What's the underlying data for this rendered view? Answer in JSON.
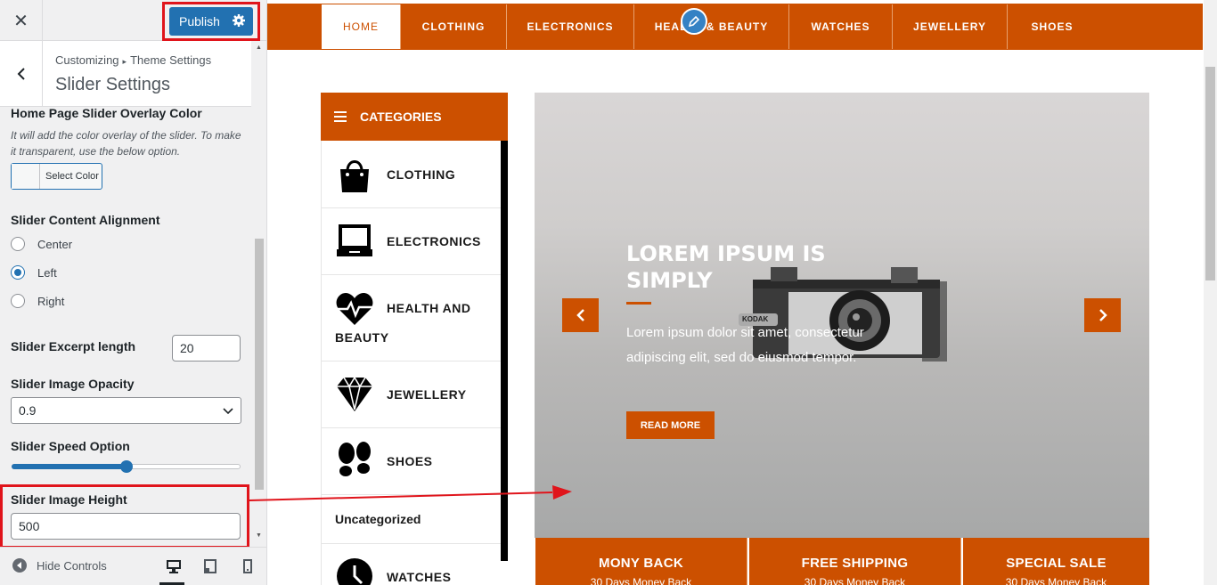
{
  "customizer": {
    "close_glyph": "✕",
    "publish_label": "Publish",
    "breadcrumb": {
      "root": "Customizing",
      "separator": "▸",
      "parent": "Theme Settings"
    },
    "section_title": "Slider Settings",
    "overlay_color": {
      "label": "Home Page Slider Overlay Color",
      "description": "It will add the color overlay of the slider. To make it transparent, use the below option.",
      "button_label": "Select Color"
    },
    "alignment": {
      "label": "Slider Content Alignment",
      "options": [
        {
          "label": "Center",
          "checked": false
        },
        {
          "label": "Left",
          "checked": true
        },
        {
          "label": "Right",
          "checked": false
        }
      ]
    },
    "excerpt": {
      "label": "Slider Excerpt length",
      "value": "20"
    },
    "opacity": {
      "label": "Slider Image Opacity",
      "value": "0.9"
    },
    "speed": {
      "label": "Slider Speed Option",
      "fraction": 0.5
    },
    "height": {
      "label": "Slider Image Height",
      "value": "500"
    },
    "footer": {
      "hide_controls_label": "Hide Controls",
      "devices": [
        "desktop-icon",
        "tablet-icon",
        "mobile-icon"
      ],
      "active_device": "desktop"
    }
  },
  "preview": {
    "nav": [
      "HOME",
      "CLOTHING",
      "ELECTRONICS",
      "HEALTH & BEAUTY",
      "WATCHES",
      "JEWELLERY",
      "SHOES"
    ],
    "categories_title": "CATEGORIES",
    "categories": [
      {
        "label": "CLOTHING",
        "icon": "shopping-bag-icon"
      },
      {
        "label": "ELECTRONICS",
        "icon": "laptop-icon"
      },
      {
        "label": "HEALTH AND",
        "label_line2": "BEAUTY",
        "icon": "heartbeat-icon"
      },
      {
        "label": "JEWELLERY",
        "icon": "diamond-icon"
      },
      {
        "label": "SHOES",
        "icon": "footprints-icon"
      },
      {
        "label": "Uncategorized",
        "icon": ""
      },
      {
        "label": "WATCHES",
        "icon": "clock-icon"
      }
    ],
    "slider": {
      "title": "LOREM IPSUM IS SIMPLY",
      "text": "Lorem ipsum dolor sit amet, consectetur adipiscing elit, sed do eiusmod tempor.",
      "button": "READ MORE",
      "camera_brand": "KODAK"
    },
    "features": [
      {
        "title": "MONY BACK",
        "subtitle": "30 Days Money Back"
      },
      {
        "title": "FREE SHIPPING",
        "subtitle": "30 Days Money Back"
      },
      {
        "title": "SPECIAL SALE",
        "subtitle": "30 Days Money Back"
      }
    ]
  },
  "colors": {
    "accent": "#cc5000",
    "wp_blue": "#2271b1",
    "highlight_red": "#e0141b"
  }
}
